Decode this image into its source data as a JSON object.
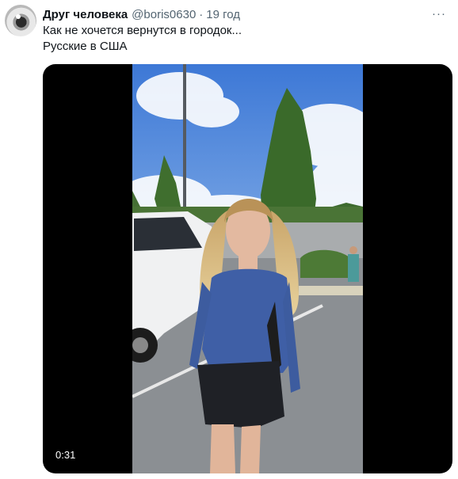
{
  "author": {
    "display_name": "Друг человека",
    "handle": "@boris0630",
    "separator": "·",
    "time": "19 год",
    "avatar_icon": "avatar-photo"
  },
  "tweet": {
    "line1": "Как не хочется вернутся в городок...",
    "line2": "Русские в США"
  },
  "menu": {
    "icon": "more-dots-icon",
    "glyph": "···"
  },
  "media": {
    "type": "video",
    "duration": "0:31"
  },
  "colors": {
    "text_primary": "#0f1419",
    "text_secondary": "#536471",
    "media_background": "#000000"
  }
}
